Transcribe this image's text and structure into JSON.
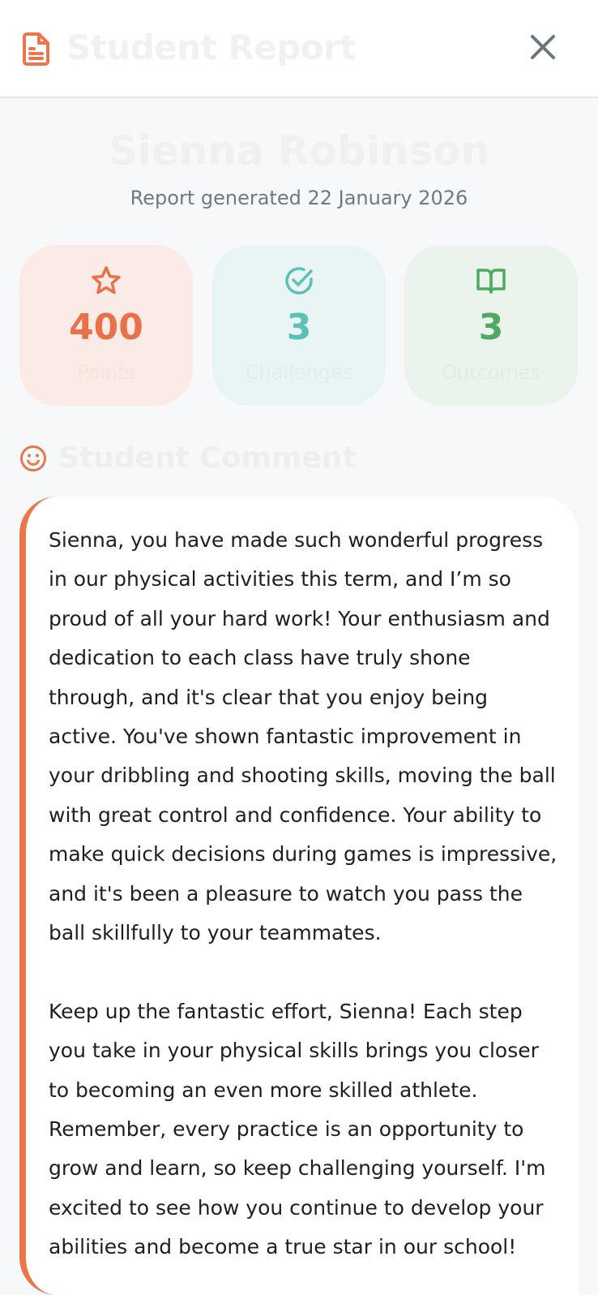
{
  "header": {
    "title": "Student Report",
    "icon": "document-icon",
    "close_icon": "close-icon"
  },
  "student": {
    "name": "Sienna Robinson",
    "report_date": "Report generated 22 January 2026"
  },
  "stats": {
    "points": {
      "value": "400",
      "label": "Points",
      "icon": "star-icon",
      "color": "#e9704a"
    },
    "challenges": {
      "value": "3",
      "label": "Challenges",
      "icon": "check-circle-icon",
      "color": "#5bc0b8"
    },
    "outcomes": {
      "value": "3",
      "label": "Outcomes",
      "icon": "book-icon",
      "color": "#4daa5e"
    }
  },
  "comment_section": {
    "title": "Student Comment",
    "icon": "smiley-icon",
    "accent_color": "#ec764c",
    "paragraphs": [
      "Sienna, you have made such wonderful progress in our physical activities this term, and I’m so proud of all your hard work! Your enthusiasm and dedication to each class have truly shone through, and it's clear that you enjoy being active. You've shown fantastic improvement in your dribbling and shooting skills, moving the ball with great control and confidence. Your ability to make quick decisions during games is impressive, and it's been a pleasure to watch you pass the ball skillfully to your teammates.",
      "Keep up the fantastic effort, Sienna! Each step you take in your physical skills brings you closer to becoming an even more skilled athlete. Remember, every practice is an opportunity to grow and learn, so keep challenging yourself. I'm excited to see how you continue to develop your abilities and become a true star in our school!"
    ]
  }
}
